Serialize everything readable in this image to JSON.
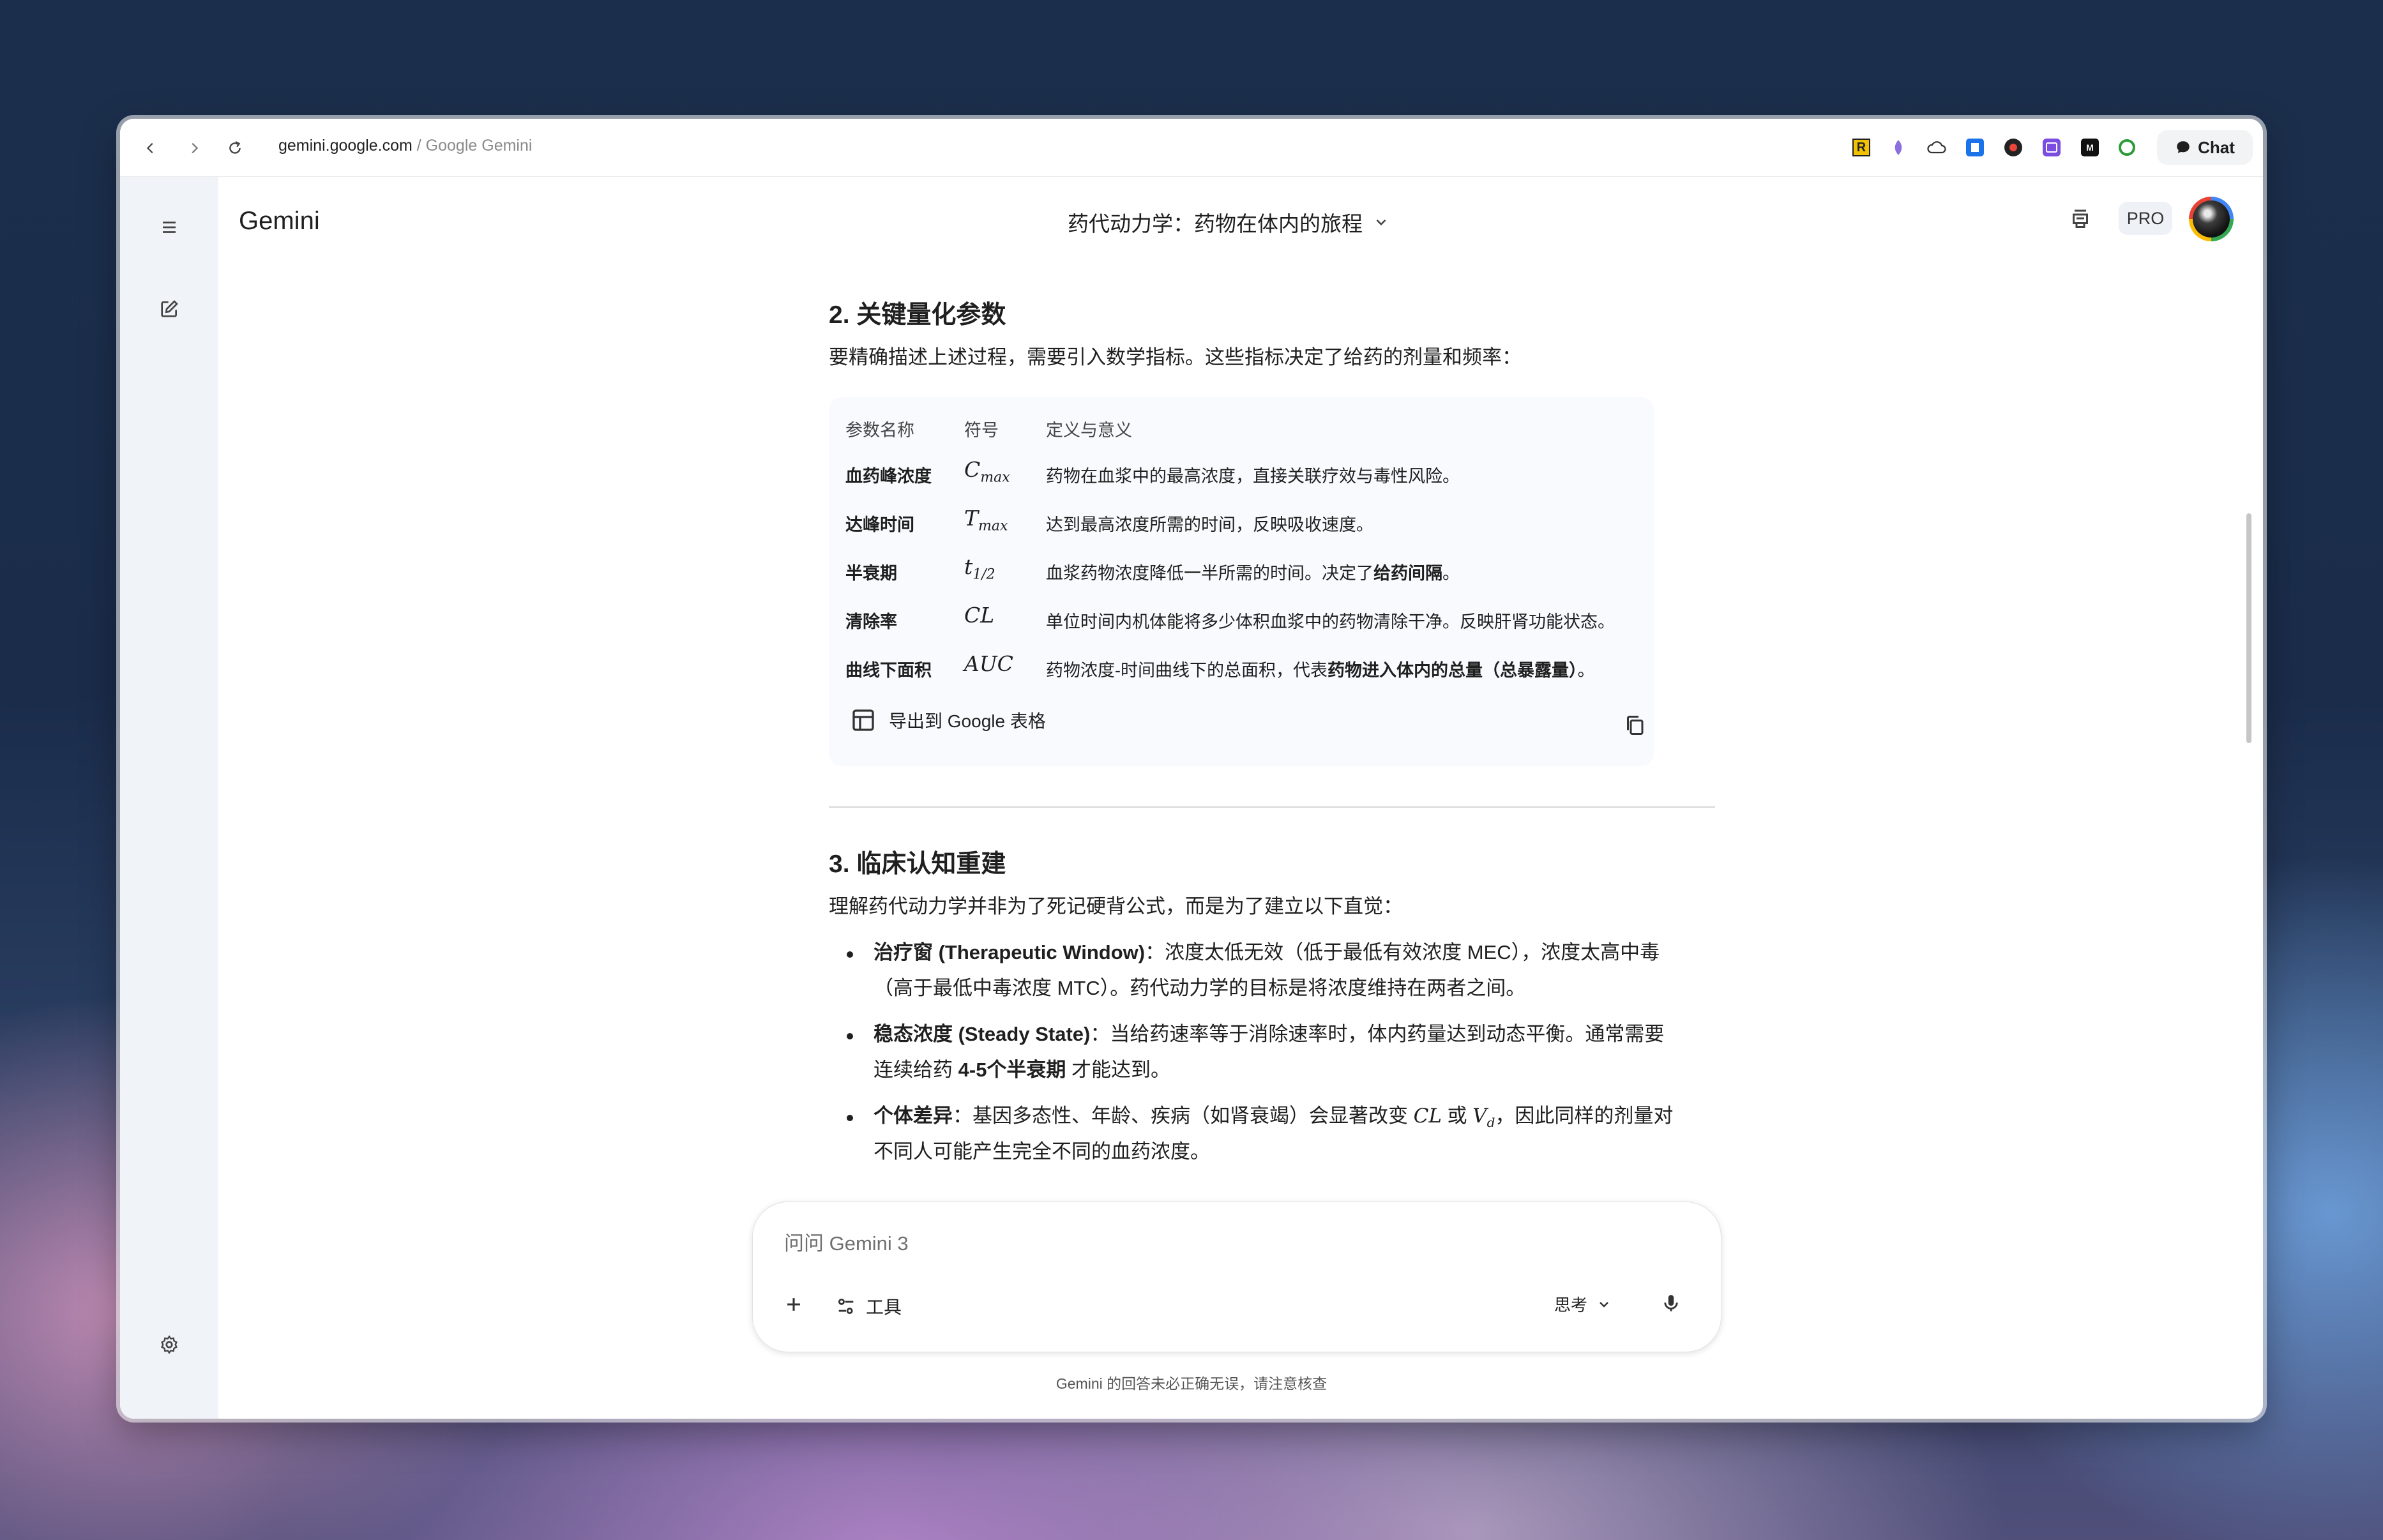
{
  "browser": {
    "url_domain": "gemini.google.com",
    "url_title": " / Google Gemini",
    "chat_label": "Chat",
    "extensions": [
      "r-extension-icon",
      "feather-extension-icon",
      "cloud-extension-icon",
      "bookmark-extension-icon",
      "record-extension-icon",
      "puzzle-extension-icon",
      "m-extension-icon",
      "circle-extension-icon"
    ]
  },
  "header": {
    "brand": "Gemini",
    "conversation_title": "药代动力学：药物在体内的旅程",
    "pro_label": "PRO"
  },
  "section2": {
    "heading": "2. 关键量化参数",
    "intro": "要精确描述上述过程，需要引入数学指标。这些指标决定了给药的剂量和频率："
  },
  "table": {
    "headers": [
      "参数名称",
      "符号",
      "定义与意义"
    ],
    "rows": [
      {
        "name": "血药峰浓度",
        "sym_base": "C",
        "sym_sub": "max",
        "def": "药物在血浆中的最高浓度，直接关联疗效与毒性风险。",
        "def_bold": "",
        "def_end": ""
      },
      {
        "name": "达峰时间",
        "sym_base": "T",
        "sym_sub": "max",
        "def": "达到最高浓度所需的时间，反映吸收速度。",
        "def_bold": "",
        "def_end": ""
      },
      {
        "name": "半衰期",
        "sym_base": "t",
        "sym_sub": "1/2",
        "def": "血浆药物浓度降低一半所需的时间。决定了",
        "def_bold": "给药间隔",
        "def_end": "。"
      },
      {
        "name": "清除率",
        "sym_base": "CL",
        "sym_sub": "",
        "def": "单位时间内机体能将多少体积血浆中的药物清除干净。反映肝肾功能状态。",
        "def_bold": "",
        "def_end": ""
      },
      {
        "name": "曲线下面积",
        "sym_base": "AUC",
        "sym_sub": "",
        "def": "药物浓度-时间曲线下的总面积，代表",
        "def_bold": "药物进入体内的总量（总暴露量）",
        "def_end": "。"
      }
    ],
    "export_label": "导出到 Google 表格"
  },
  "section3": {
    "heading": "3. 临床认知重建",
    "intro": "理解药代动力学并非为了死记硬背公式，而是为了建立以下直觉：",
    "bullets": [
      {
        "bold": "治疗窗 (Therapeutic Window)",
        "line1": "：浓度太低无效（低于最低有效浓度 MEC），浓度太高中毒",
        "line2": "（高于最低中毒浓度 MTC）。药代动力学的目标是将浓度维持在两者之间。"
      },
      {
        "bold": "稳态浓度 (Steady State)",
        "line1": "：当给药速率等于消除速率时，体内药量达到动态平衡。通常需要",
        "line2_pre": "连续给药 ",
        "line2_bold": "4-5个半衰期",
        "line2_post": " 才能达到。"
      },
      {
        "bold": "个体差异",
        "line1": "：基因多态性、年龄、疾病（如肾衰竭）会显著改变 ",
        "math1": "CL",
        "mid": " 或 ",
        "math2_base": "V",
        "math2_sub": "d",
        "line1_end": "，因此同样的剂量对",
        "line2": "不同人可能产生完全不同的血药浓度。"
      }
    ]
  },
  "composer": {
    "placeholder": "问问 Gemini 3",
    "tools_label": "工具",
    "mode_label": "思考"
  },
  "disclaimer": "Gemini 的回答未必正确无误，请注意核查"
}
